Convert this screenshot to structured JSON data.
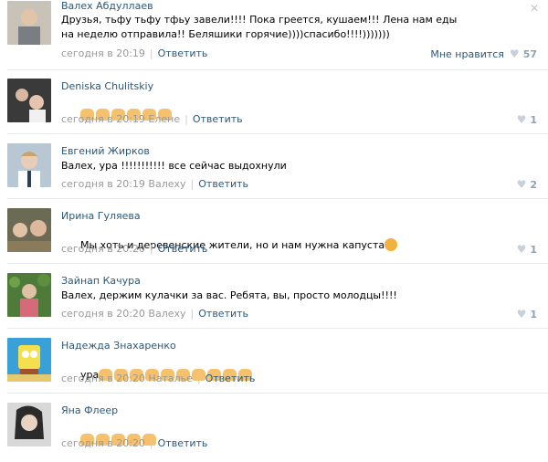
{
  "comments": [
    {
      "author": "Валех Абдуллаев",
      "text": "Друзья, тьфу тьфу тфьу завели!!!! Пока греется, кушаем!!! Лена нам еды на неделю отправила!! Беляшики горячие))))спасибо!!!!)))))))",
      "date": "сегодня в 20:19",
      "reply_to": "",
      "reply": "Ответить",
      "like_label": "Мне нравится",
      "likes": "57",
      "emoji_count": 0,
      "emoji_type": ""
    },
    {
      "author": "Deniska Chulitskiy",
      "text": "",
      "date": "сегодня в 20:19",
      "reply_to": "Елене",
      "reply": "Ответить",
      "like_label": "",
      "likes": "1",
      "emoji_count": 6,
      "emoji_type": "clap"
    },
    {
      "author": "Евгений Жирков",
      "text": "Валех, ура !!!!!!!!!!! все сейчас выдохнули",
      "date": "сегодня в 20:19",
      "reply_to": "Валеху",
      "reply": "Ответить",
      "like_label": "",
      "likes": "2",
      "emoji_count": 0,
      "emoji_type": ""
    },
    {
      "author": "Ирина Гуляева",
      "text": "Мы хоть и деревенские жители, но и нам нужна капуста",
      "date": "сегодня в 20:20",
      "reply_to": "",
      "reply": "Ответить",
      "like_label": "",
      "likes": "1",
      "emoji_count": 1,
      "emoji_type": "face"
    },
    {
      "author": "Зайнап Качура",
      "text": "Валех, держим кулачки за вас. Ребята, вы, просто молодцы!!!!",
      "date": "сегодня в 20:20",
      "reply_to": "Валеху",
      "reply": "Ответить",
      "like_label": "",
      "likes": "1",
      "emoji_count": 0,
      "emoji_type": ""
    },
    {
      "author": "Надежда Знахаренко",
      "text": "ура",
      "date": "сегодня в 20:20",
      "reply_to": "Наталье",
      "reply": "Ответить",
      "like_label": "",
      "likes": "",
      "emoji_count": 10,
      "emoji_type": "thumb"
    },
    {
      "author": "Яна Флеер",
      "text": "",
      "date": "сегодня в 20:20",
      "reply_to": "",
      "reply": "Ответить",
      "like_label": "",
      "likes": "",
      "emoji_count": 5,
      "emoji_type": "thumb"
    }
  ],
  "colors": {
    "link": "#2b587a",
    "meta": "#999999",
    "separator": "#e7eaed",
    "heart": "#c8d1db"
  },
  "icons": {
    "close": "close-icon",
    "like": "heart-icon",
    "emoji_clap": "clap-emoji-icon",
    "emoji_thumb": "thumbs-up-emoji-icon",
    "emoji_face": "grimace-emoji-icon"
  }
}
